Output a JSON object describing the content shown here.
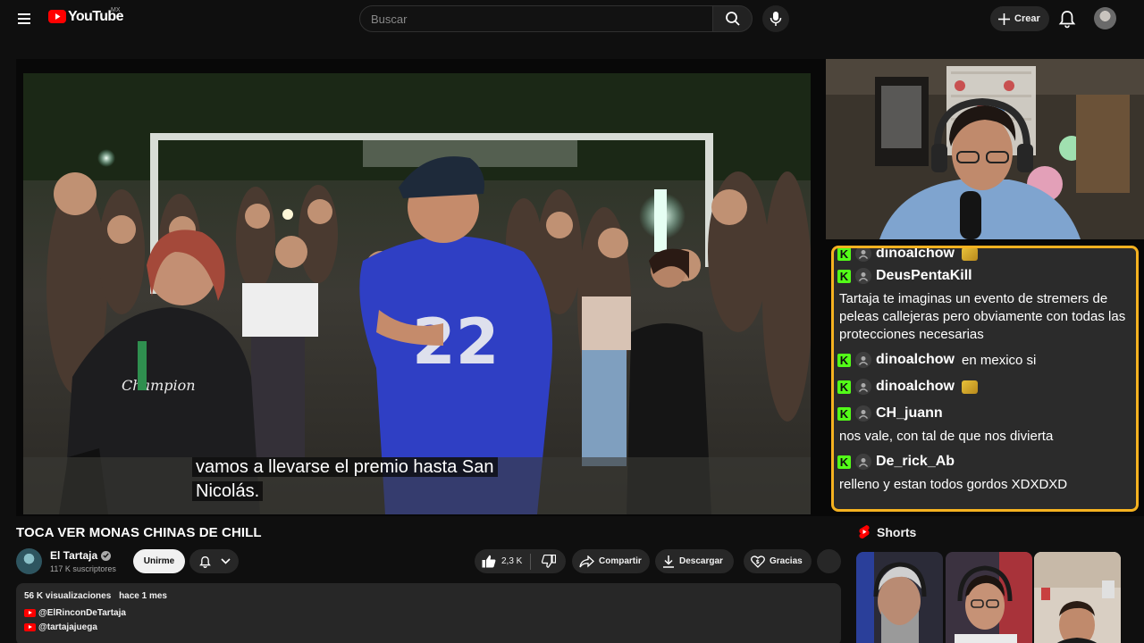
{
  "header": {
    "logo_text": "YouTube",
    "logo_country": "MX",
    "search_placeholder": "Buscar",
    "create_label": "Crear",
    "icons": [
      "menu-icon",
      "search-icon",
      "mic-icon",
      "plus-icon",
      "bell-icon"
    ]
  },
  "player": {
    "subtitle": "vamos a llevarse el premio hasta San Nicolás."
  },
  "chat": {
    "accent": "#f5b220",
    "kick_green": "#53fc18",
    "top_partial_user": "dinoalchow",
    "messages": [
      {
        "user": "DeusPentaKill",
        "text": "Tartaja te imaginas un evento de stremers de peleas callejeras pero obviamente con todas las protecciones necesarias"
      },
      {
        "user": "dinoalchow",
        "text": "en mexico si"
      },
      {
        "user": "dinoalchow",
        "text": ""
      },
      {
        "user": "CH_juann",
        "text": "nos vale, con tal de que nos divierta"
      },
      {
        "user": "De_rick_Ab",
        "text": "relleno y estan todos gordos XDXDXD"
      }
    ]
  },
  "video": {
    "title": "TOCA VER MONAS CHINAS DE CHILL",
    "channel": "El Tartaja",
    "subscribers": "117 K suscriptores",
    "join_label": "Unirme",
    "likes": "2,3 K",
    "share_label": "Compartir",
    "download_label": "Descargar",
    "thanks_label": "Gracias"
  },
  "description": {
    "views": "56 K visualizaciones",
    "date": "hace 1 mes",
    "links": [
      "@ElRinconDeTartaja",
      "@tartajajuega"
    ]
  },
  "shorts": {
    "heading": "Shorts"
  }
}
